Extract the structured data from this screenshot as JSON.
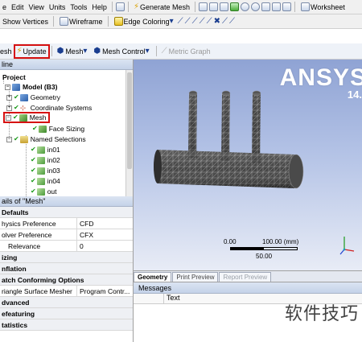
{
  "menubar": {
    "items": [
      "e",
      "Edit",
      "View",
      "Units",
      "Tools",
      "Help"
    ],
    "generate_mesh": "Generate Mesh",
    "worksheet": "Worksheet"
  },
  "toolbar2": {
    "show_vertices": "Show Vertices",
    "wireframe": "Wireframe",
    "edge_coloring": "Edge Coloring"
  },
  "toolbar3": {
    "mesh_prefix": "esh",
    "update": "Update",
    "mesh": "Mesh",
    "mesh_control": "Mesh Control",
    "metric_graph": "Metric Graph"
  },
  "tree": {
    "panel_title": "line",
    "project": "Project",
    "model": "Model (B3)",
    "geometry": "Geometry",
    "coordinate_systems": "Coordinate Systems",
    "mesh": "Mesh",
    "face_sizing": "Face Sizing",
    "named_selections": "Named Selections",
    "named_items": [
      "in01",
      "in02",
      "in03",
      "in04",
      "out"
    ]
  },
  "details": {
    "panel_title": "ails of \"Mesh\"",
    "groups": {
      "defaults": "Defaults",
      "sizing": "izing",
      "inflation": "nflation",
      "patch": "atch Conforming Options",
      "advanced": "dvanced",
      "defeaturing": "efeaturing",
      "statistics": "tatistics"
    },
    "rows": [
      {
        "key": "hysics Preference",
        "value": "CFD"
      },
      {
        "key": "olver Preference",
        "value": "CFX"
      },
      {
        "key": "Relevance",
        "value": "0"
      },
      {
        "key": "riangle Surface Mesher",
        "value": "Program Contr..."
      }
    ]
  },
  "graphics": {
    "logo": "ANSYS",
    "version": "14.",
    "scale_left": "0.00",
    "scale_right": "100.00 (mm)",
    "scale_mid": "50.00",
    "tabs": [
      "Geometry",
      "Print Preview",
      "Report Preview"
    ]
  },
  "messages": {
    "title": "Messages",
    "column_text": "Text"
  },
  "watermark": "软件技巧",
  "colors": {
    "highlight_box": "#d61010",
    "viewport_top": "#8fa3d4",
    "viewport_bottom": "#e8ecf6",
    "mesh_body": "#3a3a3a"
  }
}
